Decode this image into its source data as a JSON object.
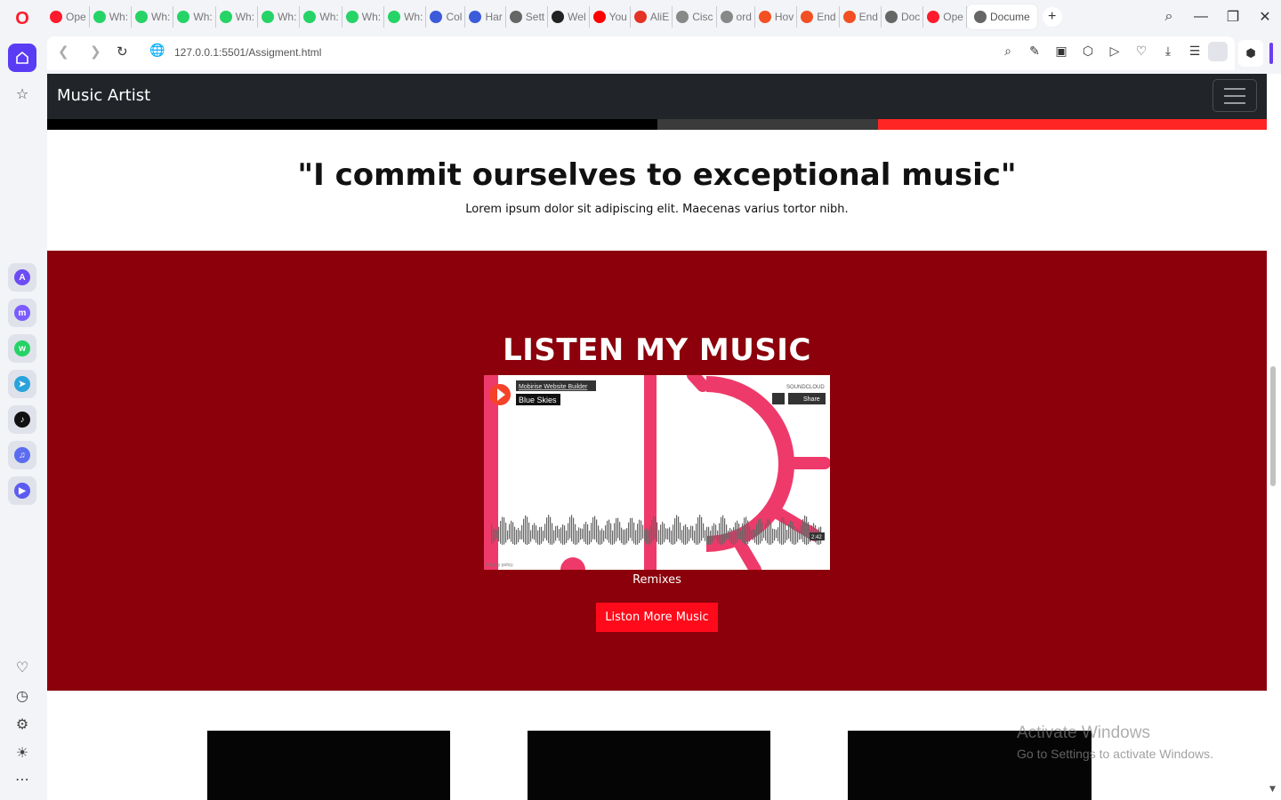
{
  "browser": {
    "tabs": [
      {
        "label": "Ope",
        "icon": "opera-icon",
        "color": "#ff1b2d"
      },
      {
        "label": "Wh:",
        "icon": "whatsapp-icon",
        "color": "#25d366"
      },
      {
        "label": "Wh:",
        "icon": "whatsapp-icon",
        "color": "#25d366"
      },
      {
        "label": "Wh:",
        "icon": "whatsapp-icon",
        "color": "#25d366"
      },
      {
        "label": "Wh:",
        "icon": "whatsapp-icon",
        "color": "#25d366"
      },
      {
        "label": "Wh:",
        "icon": "whatsapp-icon",
        "color": "#25d366"
      },
      {
        "label": "Wh:",
        "icon": "whatsapp-icon",
        "color": "#25d366"
      },
      {
        "label": "Wh:",
        "icon": "whatsapp-icon",
        "color": "#25d366"
      },
      {
        "label": "Wh:",
        "icon": "whatsapp-icon",
        "color": "#25d366"
      },
      {
        "label": "Col",
        "icon": "codepen-icon",
        "color": "#3b5bdb"
      },
      {
        "label": "Har",
        "icon": "codepen-icon",
        "color": "#3b5bdb"
      },
      {
        "label": "Sett",
        "icon": "gear-icon",
        "color": "#666666"
      },
      {
        "label": "Wel",
        "icon": "amazon-icon",
        "color": "#222222"
      },
      {
        "label": "You",
        "icon": "youtube-icon",
        "color": "#ff0000"
      },
      {
        "label": "AliE",
        "icon": "aliexpress-icon",
        "color": "#e43225"
      },
      {
        "label": "Cisc",
        "icon": "document-icon",
        "color": "#888888"
      },
      {
        "label": "ord",
        "icon": "document-icon",
        "color": "#888888"
      },
      {
        "label": "Hov",
        "icon": "microsoft-icon",
        "color": "#f25022"
      },
      {
        "label": "End",
        "icon": "microsoft-icon",
        "color": "#f25022"
      },
      {
        "label": "End",
        "icon": "microsoft-icon",
        "color": "#f25022"
      },
      {
        "label": "Doc",
        "icon": "globe-icon",
        "color": "#666666"
      },
      {
        "label": "Ope",
        "icon": "opera-icon",
        "color": "#ff1b2d"
      }
    ],
    "active_tab": {
      "label": "Docume"
    },
    "url": "127.0.0.1:5501/Assigment.html"
  },
  "page": {
    "navbar": {
      "brand": "Music Artist"
    },
    "quote": {
      "heading": "\"I commit ourselves to exceptional music\"",
      "text": "Lorem ipsum dolor sit adipiscing elit. Maecenas varius tortor nibh."
    },
    "music": {
      "title": "LISTEN MY MUSIC",
      "player": {
        "uploader": "Mobirise Website Builder",
        "track": "Blue Skies",
        "brand": "SOUNDCLOUD",
        "share_label": "Share",
        "duration": "2:42",
        "privacy": "Privacy policy"
      },
      "caption": "Remixes",
      "button": "Liston More Music"
    },
    "colors": {
      "navbar": "#212529",
      "music_bg": "#8b000b",
      "button": "#ff0a1a",
      "soundcloud_pink": "#ee3a6a"
    }
  },
  "os": {
    "watermark_title": "Activate Windows",
    "watermark_sub": "Go to Settings to activate Windows."
  }
}
